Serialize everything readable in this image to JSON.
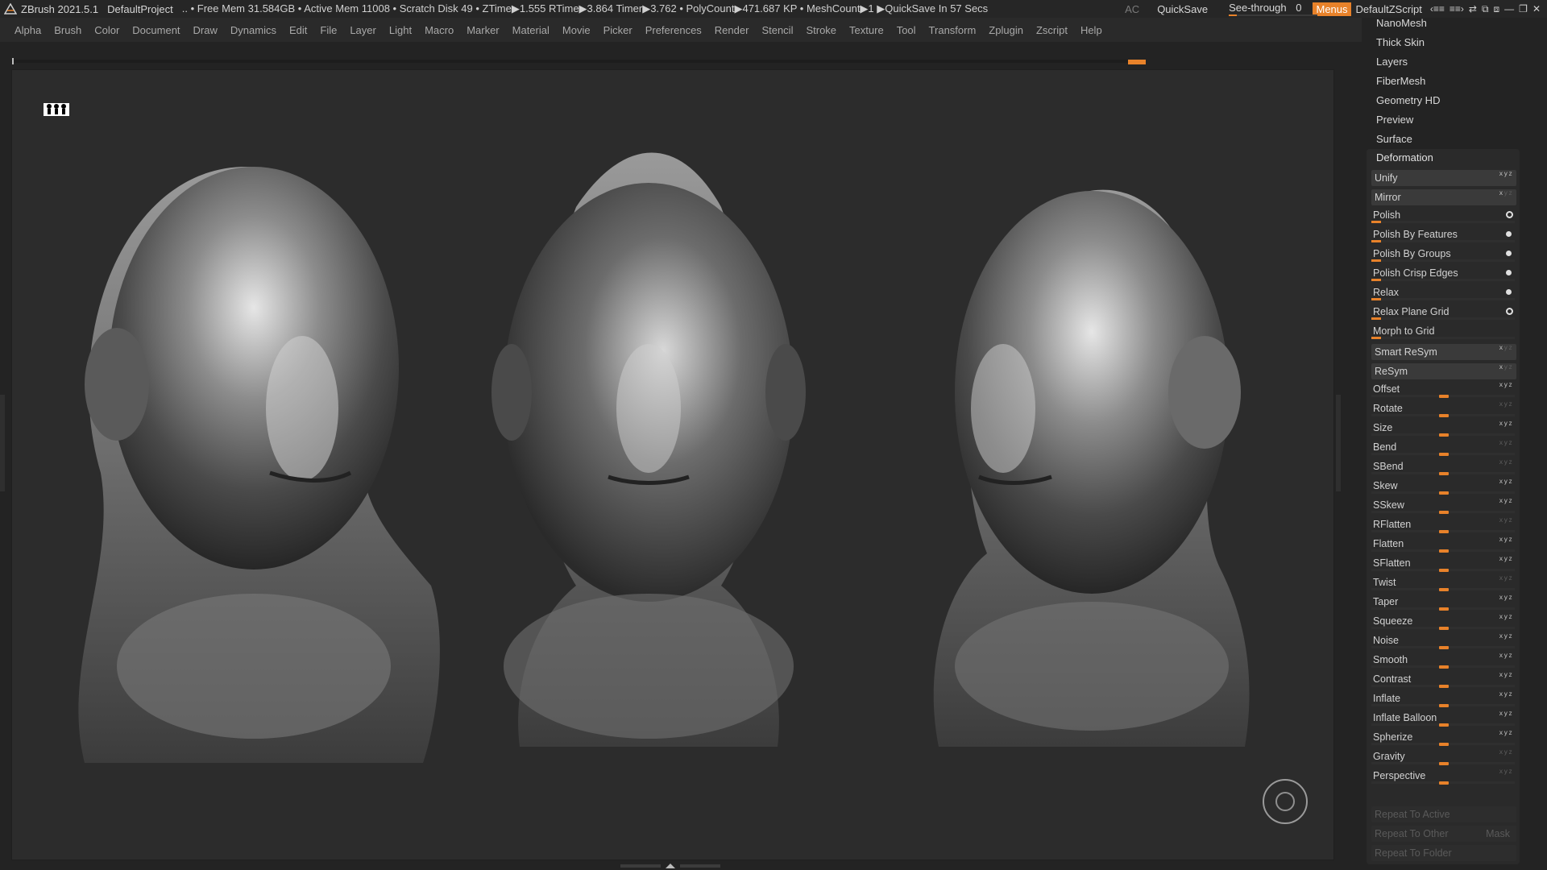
{
  "titlebar": {
    "app": "ZBrush 2021.5.1",
    "project": "DefaultProject",
    "status": "..  • Free Mem 31.584GB • Active Mem 11008 • Scratch Disk 49 •  ZTime▶1.555 RTime▶3.864 Timer▶3.762 • PolyCount▶471.687 KP  • MeshCount▶1  ▶QuickSave In 57 Secs",
    "ac": "AC",
    "quicksave": "QuickSave",
    "see_through_label": "See-through",
    "see_through_value": "0",
    "see_through_level": 0,
    "menus": "Menus",
    "script": "DefaultZScript"
  },
  "menubar": {
    "items": [
      "Alpha",
      "Brush",
      "Color",
      "Document",
      "Draw",
      "Dynamics",
      "Edit",
      "File",
      "Layer",
      "Light",
      "Macro",
      "Marker",
      "Material",
      "Movie",
      "Picker",
      "Preferences",
      "Render",
      "Stencil",
      "Stroke",
      "Texture",
      "Tool",
      "Transform",
      "Zplugin",
      "Zscript",
      "Help"
    ]
  },
  "tray": {
    "top_items": [
      "NanoMesh",
      "Thick Skin",
      "Layers",
      "FiberMesh",
      "Geometry HD",
      "Preview",
      "Surface"
    ],
    "deformation": {
      "title": "Deformation",
      "buttons": [
        "Unify",
        "Mirror"
      ],
      "polish": [
        "Polish",
        "Polish By Features",
        "Polish By Groups",
        "Polish Crisp Edges",
        "Relax",
        "Relax Plane Grid",
        "Morph to Grid"
      ],
      "sym_buttons": [
        "Smart ReSym",
        "ReSym"
      ],
      "sliders": [
        "Offset",
        "Rotate",
        "Size",
        "Bend",
        "SBend",
        "Skew",
        "SSkew",
        "RFlatten",
        "Flatten",
        "SFlatten",
        "Twist",
        "Taper",
        "Squeeze",
        "Noise",
        "Smooth",
        "Contrast",
        "Inflate",
        "Inflate Balloon",
        "Spherize",
        "Gravity",
        "Perspective"
      ],
      "repeat_active": "Repeat To Active",
      "repeat_other": "Repeat To Other",
      "mask": "Mask",
      "repeat_folder": "Repeat To Folder"
    }
  },
  "colors": {
    "accent": "#e8822a",
    "viewport": "#2c2c2c",
    "panel": "#2a2a2a"
  }
}
